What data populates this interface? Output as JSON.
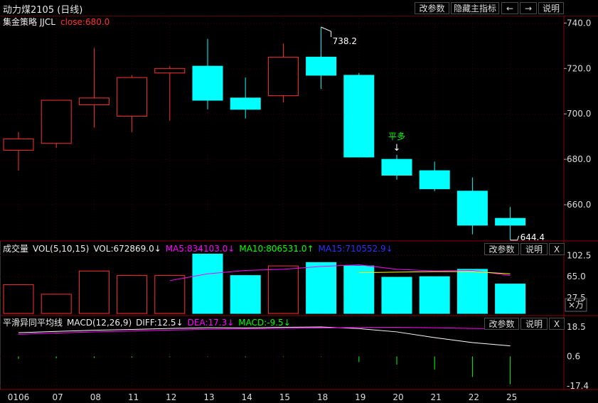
{
  "window": {
    "title": "动力煤2105 (日线)",
    "buttons": {
      "params": "改参数",
      "hide_indicator": "隐藏主指标",
      "prev": "←",
      "next": "→",
      "help": "说明"
    }
  },
  "main_panel": {
    "strategy_name": "集金策略 JJCL",
    "close_label": "close:680.0",
    "y_ticks": [
      "740.0",
      "720.0",
      "700.0",
      "680.0",
      "660.0"
    ],
    "y_tick_values": [
      740,
      720,
      700,
      680,
      660
    ],
    "high_label": "738.2",
    "low_label": "644.4",
    "signal_label": "平多",
    "signal_arrow": "↓"
  },
  "volume_panel": {
    "name": "成交量",
    "params": "VOL(5,10,15)",
    "vol": "VOL:672869.0↓",
    "ma5": "MA5:834103.0↓",
    "ma10": "MA10:806531.0↑",
    "ma15": "MA15:710552.9↓",
    "y_ticks": [
      "102.5",
      "65.0",
      "27.5"
    ],
    "unit": "×万",
    "buttons": {
      "params": "改参数",
      "help": "说明",
      "close": "X"
    }
  },
  "macd_panel": {
    "name": "平滑异同平均线",
    "params": "MACD(12,26,9)",
    "diff": "DIFF:12.5↓",
    "dea": "DEA:17.3↓",
    "macd": "MACD:-9.5↓",
    "y_ticks": [
      "18.5",
      "0.6",
      "-17.4"
    ],
    "buttons": {
      "params": "改参数",
      "help": "说明",
      "close": "X"
    }
  },
  "x_axis": {
    "labels": [
      "0106",
      "07",
      "08",
      "11",
      "12",
      "13",
      "14",
      "15",
      "18",
      "19",
      "20",
      "21",
      "22",
      "25"
    ]
  },
  "colors": {
    "bull": "#ff3030",
    "bear": "#00ffff",
    "ma5": "#ff00ff",
    "ma10": "#ffff00",
    "ma15": "#3030ff",
    "diff": "#ffffff",
    "dea": "#ff00ff",
    "macd_neg": "#00ff00",
    "signal": "#00ff00"
  },
  "chart_data": {
    "type": "candlestick",
    "dates": [
      "0106",
      "07",
      "08",
      "11",
      "12",
      "13",
      "14",
      "15",
      "18",
      "19",
      "20",
      "21",
      "22",
      "25"
    ],
    "ohlc": [
      [
        684,
        692,
        675,
        689
      ],
      [
        687,
        706,
        685,
        706
      ],
      [
        704,
        729,
        694,
        707
      ],
      [
        699,
        717,
        692,
        716
      ],
      [
        718,
        721,
        697,
        720
      ],
      [
        721,
        733,
        702,
        706
      ],
      [
        707,
        716,
        698,
        702
      ],
      [
        708,
        731,
        705,
        725
      ],
      [
        725,
        738.2,
        711,
        717
      ],
      [
        717,
        718,
        681,
        681
      ],
      [
        680,
        682,
        671,
        673
      ],
      [
        675,
        679,
        666,
        667
      ],
      [
        666,
        672,
        647,
        651
      ],
      [
        654,
        659,
        644.4,
        651
      ]
    ],
    "volume": [
      51,
      34,
      75,
      67,
      67,
      105,
      67,
      84,
      90,
      84,
      64,
      65,
      78,
      52
    ],
    "vol_ma5": [
      null,
      null,
      null,
      null,
      58,
      70,
      76,
      78,
      83,
      86,
      78,
      75,
      76,
      67
    ],
    "vol_ma10": [
      null,
      null,
      null,
      null,
      null,
      null,
      null,
      null,
      null,
      72,
      73,
      74,
      74,
      70
    ],
    "vol_ma15": [
      null,
      null,
      null,
      null,
      null,
      null,
      null,
      null,
      null,
      null,
      null,
      null,
      null,
      71
    ],
    "diff": [
      15.0,
      15.8,
      16.5,
      17.0,
      17.6,
      18.0,
      17.9,
      18.3,
      18.5,
      17.5,
      15.5,
      12.0,
      9.0,
      7.0
    ],
    "dea": [
      14.0,
      14.8,
      15.5,
      16.0,
      16.6,
      17.1,
      17.3,
      17.6,
      17.9,
      18.2,
      18.3,
      18.0,
      17.6,
      17.3
    ],
    "macd": [
      -1.5,
      -1.2,
      -1.0,
      -0.8,
      -0.4,
      -0.2,
      -0.5,
      -0.3,
      -0.2,
      -3.5,
      -5.0,
      -8.0,
      -12.5,
      -17.0
    ],
    "y_range": [
      645,
      742
    ],
    "vol_range": [
      0,
      108
    ],
    "macd_range": [
      -17.4,
      18.5
    ]
  }
}
